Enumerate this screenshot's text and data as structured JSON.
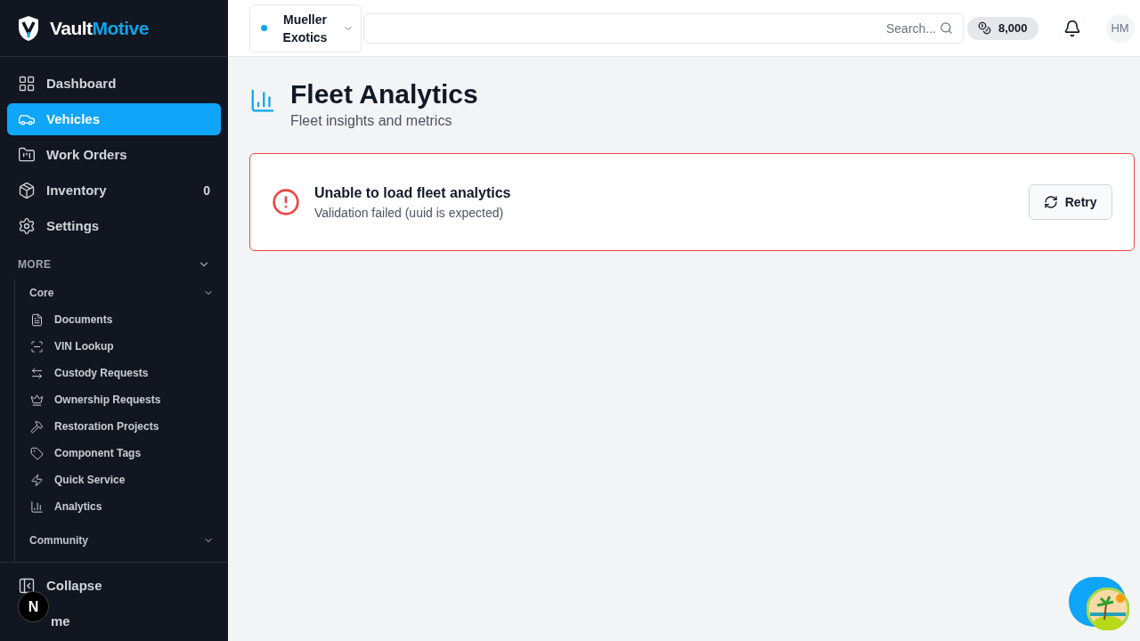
{
  "brand": {
    "part1": "Vault",
    "part2": "Motive"
  },
  "nav": [
    {
      "label": "Dashboard",
      "selected": false
    },
    {
      "label": "Vehicles",
      "selected": true
    },
    {
      "label": "Work Orders",
      "selected": false
    },
    {
      "label": "Inventory",
      "selected": false,
      "count": "0"
    },
    {
      "label": "Settings",
      "selected": false
    }
  ],
  "more": {
    "label": "MORE",
    "expanded": true,
    "groups": [
      {
        "label": "Core",
        "items": [
          {
            "label": "Documents"
          },
          {
            "label": "VIN Lookup"
          },
          {
            "label": "Custody Requests"
          },
          {
            "label": "Ownership Requests"
          },
          {
            "label": "Restoration Projects"
          },
          {
            "label": "Component Tags"
          },
          {
            "label": "Quick Service"
          },
          {
            "label": "Analytics"
          }
        ]
      },
      {
        "label": "Community"
      }
    ]
  },
  "footer": {
    "collapse": "Collapse",
    "theme": "me",
    "badge": "N"
  },
  "header": {
    "org": {
      "line1": "Mueller",
      "line2": "Exotics",
      "color": "#0ea5e9"
    },
    "search": {
      "placeholder": "Search..."
    },
    "credits": "8,000",
    "avatar": "HM"
  },
  "page": {
    "title": "Fleet Analytics",
    "subtitle": "Fleet insights and metrics"
  },
  "error": {
    "title": "Unable to load fleet analytics",
    "message": "Validation failed (uuid is expected)",
    "button": "Retry"
  }
}
